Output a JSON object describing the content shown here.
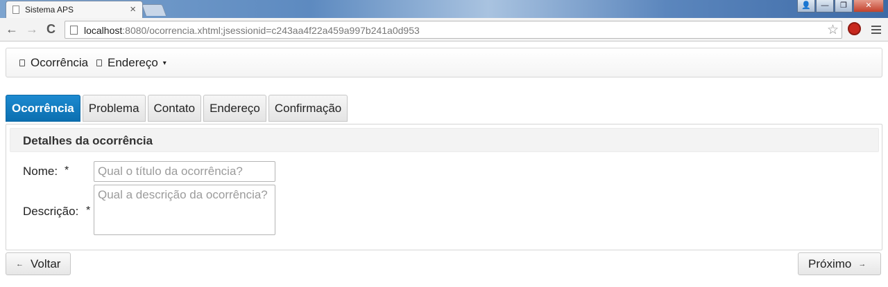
{
  "browser": {
    "tab_title": "Sistema APS",
    "tab_close": "×",
    "url_host": "localhost",
    "url_rest": ":8080/ocorrencia.xhtml;jsessionid=c243aa4f22a459a997b241a0d953",
    "back_glyph": "←",
    "forward_glyph": "→",
    "reload_glyph": "C",
    "star_glyph": "☆",
    "window_controls": {
      "user": "👤",
      "minimize": "—",
      "restore": "❐",
      "close": "✕"
    },
    "icons": [
      "back-icon",
      "forward-icon",
      "reload-icon",
      "page-icon",
      "star-icon",
      "extension-icon",
      "menu-icon"
    ]
  },
  "menubar": {
    "items": [
      {
        "label": "Ocorrência"
      },
      {
        "label": "Endereço",
        "caret": "▾"
      }
    ]
  },
  "wizard": {
    "tabs": [
      {
        "label": "Ocorrência",
        "active": true
      },
      {
        "label": "Problema"
      },
      {
        "label": "Contato"
      },
      {
        "label": "Endereço"
      },
      {
        "label": "Confirmação"
      }
    ]
  },
  "panel": {
    "title": "Detalhes da ocorrência",
    "fields": [
      {
        "label": "Nome:",
        "required": "*",
        "value": "",
        "placeholder": "Qual o título da ocorrência?"
      },
      {
        "label": "Descrição:",
        "required": "*",
        "value": "",
        "placeholder": "Qual a descrição da ocorrência?"
      }
    ]
  },
  "buttons": {
    "back_label": "Voltar",
    "back_arrow": "←",
    "next_label": "Próximo",
    "next_arrow": "→"
  },
  "colors": {
    "active_tab": "#0b6fb0",
    "title_bar": "#5d8ac0"
  }
}
